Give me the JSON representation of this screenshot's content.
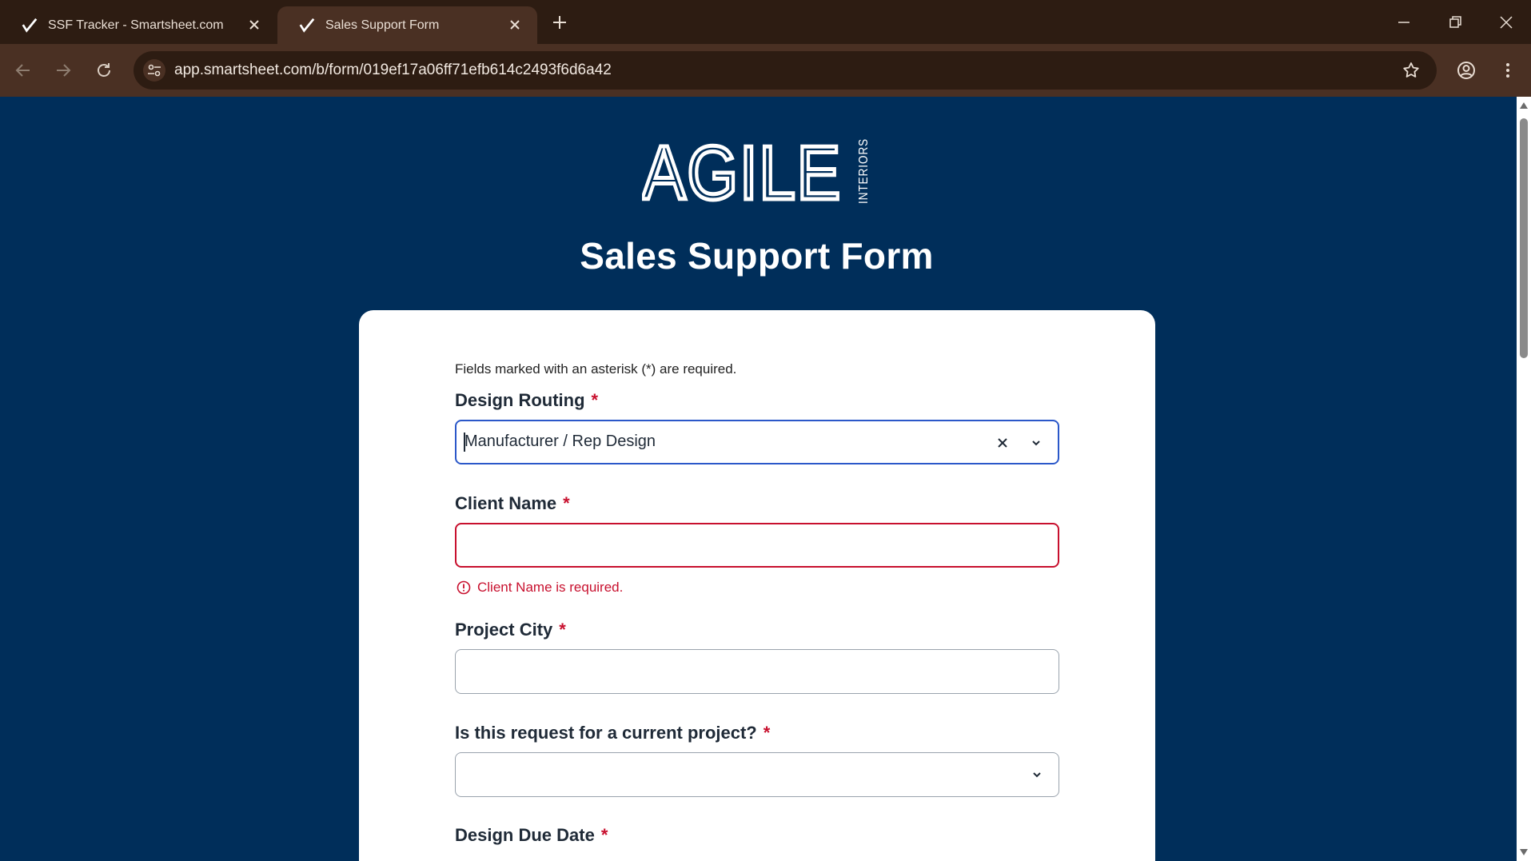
{
  "browser": {
    "tabs": [
      {
        "title": "SSF Tracker - Smartsheet.com",
        "active": false
      },
      {
        "title": "Sales Support Form",
        "active": true
      }
    ],
    "url": "app.smartsheet.com/b/form/019ef17a06ff71efb614c2493f6d6a42"
  },
  "logo": {
    "main": "AGILE",
    "sub": "INTERIORS"
  },
  "page": {
    "title": "Sales Support Form"
  },
  "form": {
    "required_note": "Fields marked with an asterisk (*) are required.",
    "required_marker": "*",
    "fields": [
      {
        "label": "Design Routing",
        "type": "select",
        "value": "Manufacturer / Rep Design"
      },
      {
        "label": "Client Name",
        "type": "text",
        "value": "",
        "error": "Client Name is required."
      },
      {
        "label": "Project City",
        "type": "text",
        "value": ""
      },
      {
        "label": "Is this request for a current project?",
        "type": "select",
        "value": ""
      },
      {
        "label": "Design Due Date",
        "type": "date",
        "value": ""
      }
    ]
  },
  "colors": {
    "page_bg": "#002e5a",
    "error": "#c8102e",
    "focus": "#2b58c9",
    "tab_bar": "#2d1c12",
    "toolbar": "#4a3023"
  }
}
